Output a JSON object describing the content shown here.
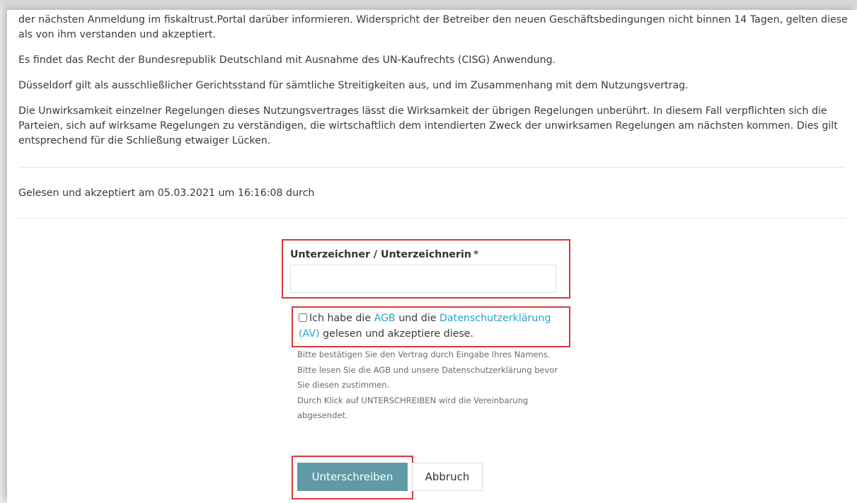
{
  "contract": {
    "paragraphs": [
      "der nächsten Anmeldung im fiskaltrust.Portal darüber informieren. Widerspricht der Betreiber den neuen Geschäftsbedingungen nicht binnen 14 Tagen, gelten diese als von ihm verstanden und akzeptiert.",
      "Es findet das Recht der Bundesrepublik Deutschland mit Ausnahme des UN-Kaufrechts (CISG) Anwendung.",
      "Düsseldorf gilt als ausschließlicher Gerichtsstand für sämtliche Streitigkeiten aus, und im Zusammenhang mit dem Nutzungsvertrag.",
      "Die Unwirksamkeit einzelner Regelungen dieses Nutzungsvertrages lässt die Wirksamkeit der übrigen Regelungen unberührt. In diesem Fall verpflichten sich die Parteien, sich auf wirksame Regelungen zu verständigen, die wirtschaftlich dem intendierten Zweck der unwirksamen Regelungen am nächsten kommen. Dies gilt entsprechend für die Schließung etwaiger Lücken."
    ],
    "accepted_line": "Gelesen und akzeptiert am 05.03.2021 um 16:16:08 durch"
  },
  "form": {
    "signer_label": "Unterzeichner / Unterzeichnerin",
    "required_mark": "*",
    "signer_value": "",
    "agree_prefix": "Ich habe die",
    "agb_link": "AGB",
    "agree_middle": "und die",
    "privacy_link": "Datenschutzerklärung (AV)",
    "agree_suffix": "gelesen und akzeptiere diese.",
    "agree_checked": false,
    "hints": [
      "Bitte bestätigen Sie den Vertrag durch Eingabe Ihres Namens.",
      "Bitte lesen Sie die AGB und unsere Datenschutzerklärung bevor Sie diesen zustimmen.",
      "Durch Klick auf UNTERSCHREIBEN wird die Vereinbarung abgesendet."
    ],
    "sign_button": "Unterschreiben",
    "cancel_button": "Abbruch"
  },
  "colors": {
    "highlight": "#d8393a",
    "link": "#2aa3c9",
    "primary_button": "#5f9aa6"
  }
}
